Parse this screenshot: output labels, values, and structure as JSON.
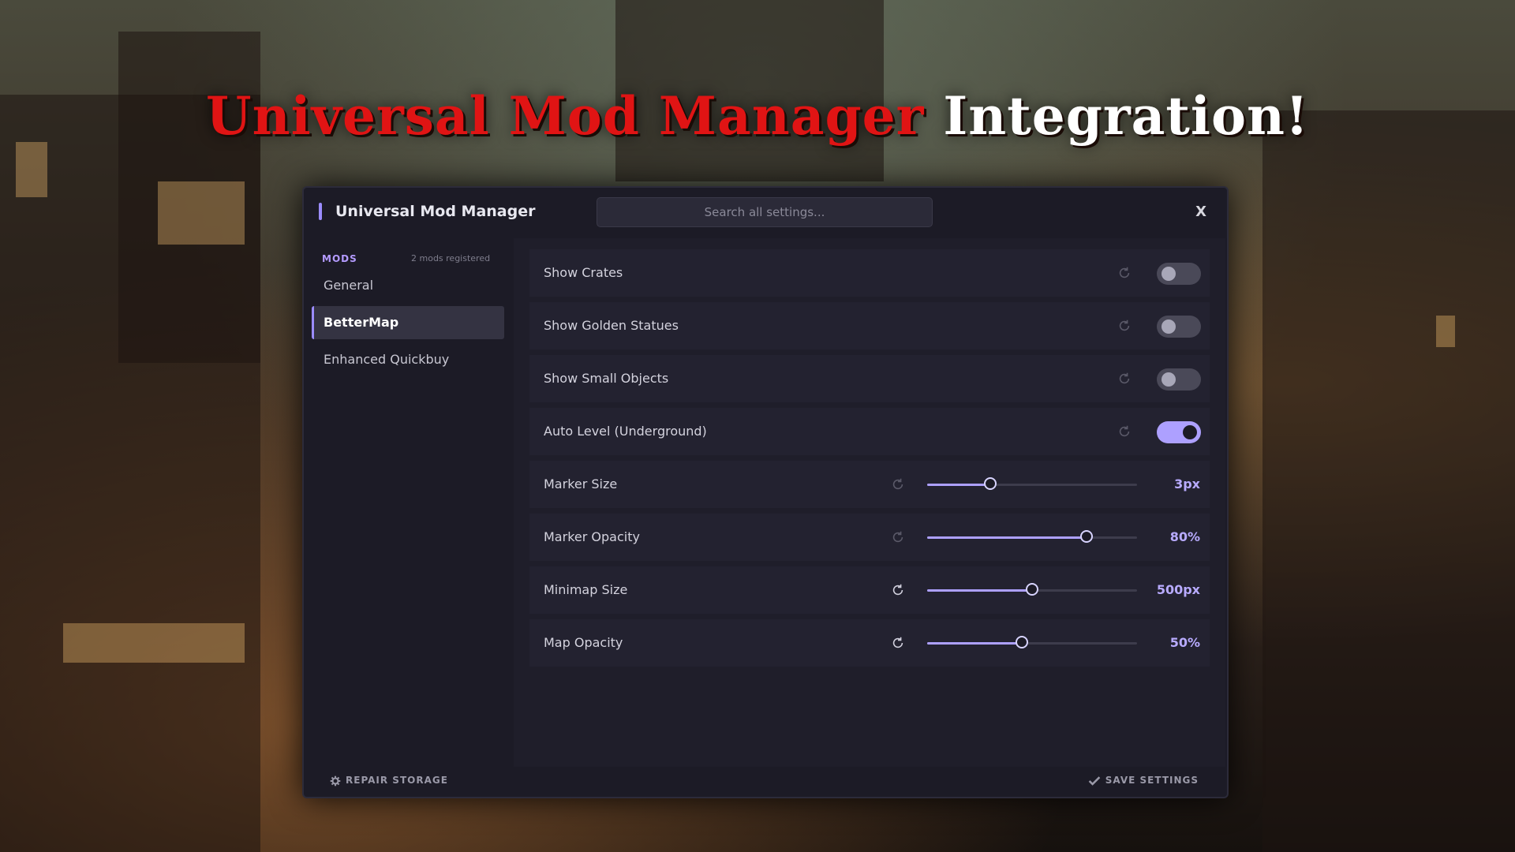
{
  "headline": {
    "part1": "Universal Mod Manager",
    "part2": "Integration!"
  },
  "window": {
    "title": "Universal Mod Manager",
    "search_placeholder": "Search all settings...",
    "close_label": "X"
  },
  "sidebar": {
    "section_label": "MODS",
    "count_text": "2 mods registered",
    "items": [
      {
        "label": "General",
        "active": false
      },
      {
        "label": "BetterMap",
        "active": true
      },
      {
        "label": "Enhanced Quickbuy",
        "active": false
      }
    ]
  },
  "settings": [
    {
      "label": "Show Crates",
      "type": "toggle",
      "on": false
    },
    {
      "label": "Show Golden Statues",
      "type": "toggle",
      "on": false
    },
    {
      "label": "Show Small Objects",
      "type": "toggle",
      "on": false
    },
    {
      "label": "Auto Level (Underground)",
      "type": "toggle",
      "on": true
    },
    {
      "label": "Marker Size",
      "type": "slider",
      "value": "3px",
      "level": 0.3
    },
    {
      "label": "Marker Opacity",
      "type": "slider",
      "value": "80%",
      "level": 0.76
    },
    {
      "label": "Minimap Size",
      "type": "slider",
      "value": "500px",
      "level": 0.5
    },
    {
      "label": "Map Opacity",
      "type": "slider",
      "value": "50%",
      "level": 0.45
    }
  ],
  "footer": {
    "repair_label": "REPAIR STORAGE",
    "save_label": "SAVE SETTINGS"
  },
  "colors": {
    "accent": "#ada0ff",
    "headline_red": "#e01414",
    "panel_bg": "#1c1b26"
  },
  "icons": {
    "reset": "refresh-icon",
    "repair": "gear-icon",
    "save": "checkmark-icon"
  }
}
